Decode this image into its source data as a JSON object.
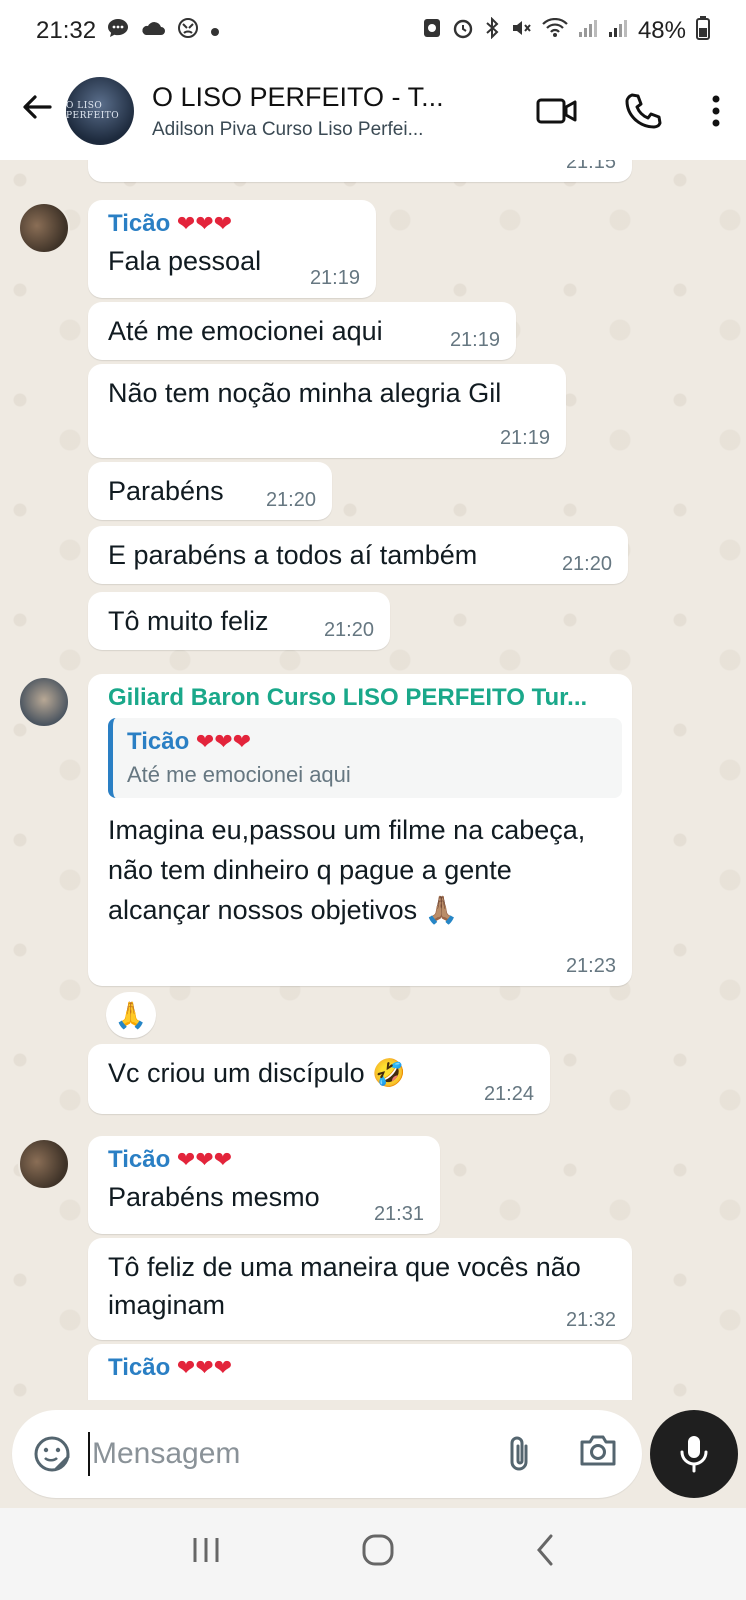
{
  "status_bar": {
    "time": "21:32",
    "battery": "48%"
  },
  "header": {
    "title": "O LISO PERFEITO - T...",
    "subtitle": "Adilson Piva Curso Liso Perfei...",
    "avatar_text": "O LISO PERFEITO",
    "icons": [
      "back-arrow-icon",
      "video-call-icon",
      "phone-icon",
      "more-vert-icon"
    ]
  },
  "messages": [
    {
      "time": "21:15"
    },
    {
      "sender": "Ticão",
      "hearts": "❤❤❤",
      "text": "Fala pessoal",
      "time": "21:19"
    },
    {
      "text": "Até me emocionei aqui",
      "time": "21:19"
    },
    {
      "text": "Não tem noção minha alegria Gil",
      "time": "21:19"
    },
    {
      "text": "Parabéns",
      "time": "21:20"
    },
    {
      "text": "E parabéns a todos aí também",
      "time": "21:20"
    },
    {
      "text": "Tô muito feliz",
      "time": "21:20"
    },
    {
      "sender": "Giliard Baron Curso LISO PERFEITO Tur...",
      "quote_sender": "Ticão",
      "quote_hearts": "❤❤❤",
      "quote_text": "Até me emocionei aqui",
      "text": "Imagina eu,passou um filme na cabeça, não tem dinheiro q pague a gente alcançar nossos objetivos 🙏🏽",
      "time": "21:23",
      "reaction": "🙏"
    },
    {
      "text": "Vc criou um discípulo 🤣",
      "time": "21:24"
    },
    {
      "sender": "Ticão",
      "hearts": "❤❤❤",
      "text": "Parabéns mesmo",
      "time": "21:31"
    },
    {
      "text": "Tô feliz de uma maneira que vocês não imaginam",
      "time": "21:32"
    },
    {
      "sender": "Ticão",
      "hearts": "❤❤❤"
    }
  ],
  "input": {
    "placeholder": "Mensagem"
  }
}
